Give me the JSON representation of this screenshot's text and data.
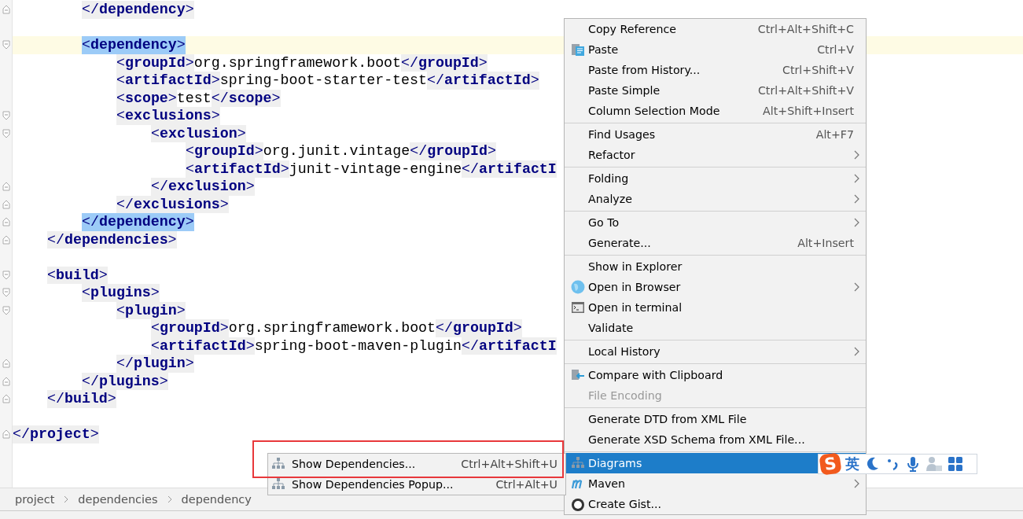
{
  "editor": {
    "lines": [
      {
        "fold_end": true,
        "current": false,
        "segments": [
          {
            "kind": "close",
            "text": "</**dependency**>",
            "selected": false
          }
        ]
      },
      {
        "current": false
      },
      {
        "fold_start": true,
        "current": true,
        "segments": [
          {
            "kind": "open",
            "text": "<**dependency**>",
            "selected": true
          }
        ]
      },
      {
        "current": false,
        "segments": [
          {
            "kind": "open",
            "text": "<**groupId**>",
            "selected": false
          },
          {
            "kind": "text",
            "text": "org.springframework.boot"
          },
          {
            "kind": "close",
            "text": "</**groupId**>",
            "selected": false
          }
        ]
      },
      {
        "current": false,
        "segments": [
          {
            "kind": "open",
            "text": "<**artifactId**>",
            "selected": false
          },
          {
            "kind": "text",
            "text": "spring-boot-starter-test"
          },
          {
            "kind": "close",
            "text": "</**artifactId**>",
            "selected": false
          }
        ]
      },
      {
        "current": false,
        "segments": [
          {
            "kind": "open",
            "text": "<**scope**>",
            "selected": false
          },
          {
            "kind": "text",
            "text": "test"
          },
          {
            "kind": "close",
            "text": "</**scope**>",
            "selected": false
          }
        ]
      },
      {
        "fold_start": true,
        "current": false,
        "segments": [
          {
            "kind": "open",
            "text": "<**exclusions**>",
            "selected": false
          }
        ]
      },
      {
        "fold_start": true,
        "current": false,
        "segments": [
          {
            "kind": "open",
            "text": "<**exclusion**>",
            "selected": false
          }
        ]
      },
      {
        "current": false,
        "segments": [
          {
            "kind": "open",
            "text": "<**groupId**>",
            "selected": false
          },
          {
            "kind": "text",
            "text": "org.junit.vintage"
          },
          {
            "kind": "close",
            "text": "</**groupId**>",
            "selected": false
          }
        ]
      },
      {
        "current": false,
        "segments": [
          {
            "kind": "open",
            "text": "<**artifactId**>",
            "selected": false
          },
          {
            "kind": "text",
            "text": "junit-vintage-engine"
          },
          {
            "kind": "close",
            "text": "</**artifactI**",
            "selected": false
          }
        ]
      },
      {
        "fold_end": true,
        "current": false,
        "segments": [
          {
            "kind": "close",
            "text": "</**exclusion**>",
            "selected": false
          }
        ]
      },
      {
        "fold_end": true,
        "current": false,
        "segments": [
          {
            "kind": "close",
            "text": "</**exclusions**>",
            "selected": false
          }
        ]
      },
      {
        "fold_end": true,
        "current": false,
        "segments": [
          {
            "kind": "close",
            "text": "</**dependency**>",
            "selected": true
          }
        ]
      },
      {
        "fold_end": true,
        "current": false,
        "segments": [
          {
            "kind": "close",
            "text": "</**dependencies**>",
            "selected": false
          }
        ]
      },
      {
        "current": false
      },
      {
        "fold_start": true,
        "current": false,
        "segments": [
          {
            "kind": "open",
            "text": "<**build**>",
            "selected": false
          }
        ]
      },
      {
        "fold_start": true,
        "current": false,
        "segments": [
          {
            "kind": "open",
            "text": "<**plugins**>",
            "selected": false
          }
        ]
      },
      {
        "fold_start": true,
        "current": false,
        "segments": [
          {
            "kind": "open",
            "text": "<**plugin**>",
            "selected": false
          }
        ]
      },
      {
        "current": false,
        "segments": [
          {
            "kind": "open",
            "text": "<**groupId**>",
            "selected": false
          },
          {
            "kind": "text",
            "text": "org.springframework.boot"
          },
          {
            "kind": "close",
            "text": "</**groupId**>",
            "selected": false
          }
        ]
      },
      {
        "current": false,
        "segments": [
          {
            "kind": "open",
            "text": "<**artifactId**>",
            "selected": false
          },
          {
            "kind": "text",
            "text": "spring-boot-maven-plugin"
          },
          {
            "kind": "close",
            "text": "</**artifactI**",
            "selected": false
          }
        ]
      },
      {
        "fold_end": true,
        "current": false,
        "segments": [
          {
            "kind": "close",
            "text": "</**plugin**>",
            "selected": false
          }
        ]
      },
      {
        "fold_end": true,
        "current": false,
        "segments": [
          {
            "kind": "close",
            "text": "</**plugins**>",
            "selected": false
          }
        ]
      },
      {
        "fold_end": true,
        "current": false,
        "segments": [
          {
            "kind": "close",
            "text": "</**build**>",
            "selected": false
          }
        ]
      },
      {
        "current": false
      },
      {
        "fold_end": true,
        "current": false,
        "segments": [
          {
            "kind": "close",
            "text": "</**project**>",
            "selected": false
          }
        ]
      }
    ]
  },
  "breadcrumbs": [
    "project",
    "dependencies",
    "dependency"
  ],
  "context_menu": {
    "groups": [
      [
        {
          "label": "Copy Reference",
          "shortcut": "Ctrl+Alt+Shift+C",
          "submenu": false,
          "disabled": false,
          "selected": false
        },
        {
          "label": "Paste",
          "shortcut": "Ctrl+V",
          "submenu": false,
          "disabled": false,
          "selected": false
        },
        {
          "label": "Paste from History...",
          "shortcut": "Ctrl+Shift+V",
          "submenu": false,
          "disabled": false,
          "selected": false
        },
        {
          "label": "Paste Simple",
          "shortcut": "Ctrl+Alt+Shift+V",
          "submenu": false,
          "disabled": false,
          "selected": false
        },
        {
          "label": "Column Selection Mode",
          "shortcut": "Alt+Shift+Insert",
          "submenu": false,
          "disabled": false,
          "selected": false
        }
      ],
      [
        {
          "label": "Find Usages",
          "shortcut": "Alt+F7",
          "submenu": false,
          "disabled": false,
          "selected": false
        },
        {
          "label": "Refactor",
          "submenu": true,
          "disabled": false,
          "selected": false
        }
      ],
      [
        {
          "label": "Folding",
          "submenu": true,
          "disabled": false,
          "selected": false
        },
        {
          "label": "Analyze",
          "submenu": true,
          "disabled": false,
          "selected": false
        }
      ],
      [
        {
          "label": "Go To",
          "submenu": true,
          "disabled": false,
          "selected": false
        },
        {
          "label": "Generate...",
          "shortcut": "Alt+Insert",
          "submenu": false,
          "disabled": false,
          "selected": false
        }
      ],
      [
        {
          "label": "Show in Explorer",
          "submenu": false,
          "disabled": false,
          "selected": false
        },
        {
          "label": "Open in Browser",
          "submenu": true,
          "disabled": false,
          "selected": false
        },
        {
          "label": "Open in terminal",
          "submenu": false,
          "disabled": false,
          "selected": false
        },
        {
          "label": "Validate",
          "submenu": false,
          "disabled": false,
          "selected": false
        }
      ],
      [
        {
          "label": "Local History",
          "submenu": true,
          "disabled": false,
          "selected": false
        }
      ],
      [
        {
          "label": "Compare with Clipboard",
          "submenu": false,
          "disabled": false,
          "selected": false
        },
        {
          "label": "File Encoding",
          "submenu": false,
          "disabled": true,
          "selected": false
        }
      ],
      [
        {
          "label": "Generate DTD from XML File",
          "submenu": false,
          "disabled": false,
          "selected": false
        },
        {
          "label": "Generate XSD Schema from XML File...",
          "submenu": false,
          "disabled": false,
          "selected": false
        }
      ],
      [
        {
          "label": "Diagrams",
          "submenu": false,
          "disabled": false,
          "selected": true
        },
        {
          "label": "Maven",
          "submenu": true,
          "disabled": false,
          "selected": false
        },
        {
          "label": "Create Gist...",
          "submenu": false,
          "disabled": false,
          "selected": false
        }
      ]
    ]
  },
  "submenu": {
    "items": [
      {
        "label": "Show Dependencies...",
        "shortcut": "Ctrl+Alt+Shift+U",
        "selected": false
      },
      {
        "label": "Show Dependencies Popup...",
        "shortcut": "Ctrl+Alt+U",
        "selected": false
      }
    ]
  },
  "ime_toolbar": {
    "logo_letter": "S",
    "mode": "英"
  }
}
